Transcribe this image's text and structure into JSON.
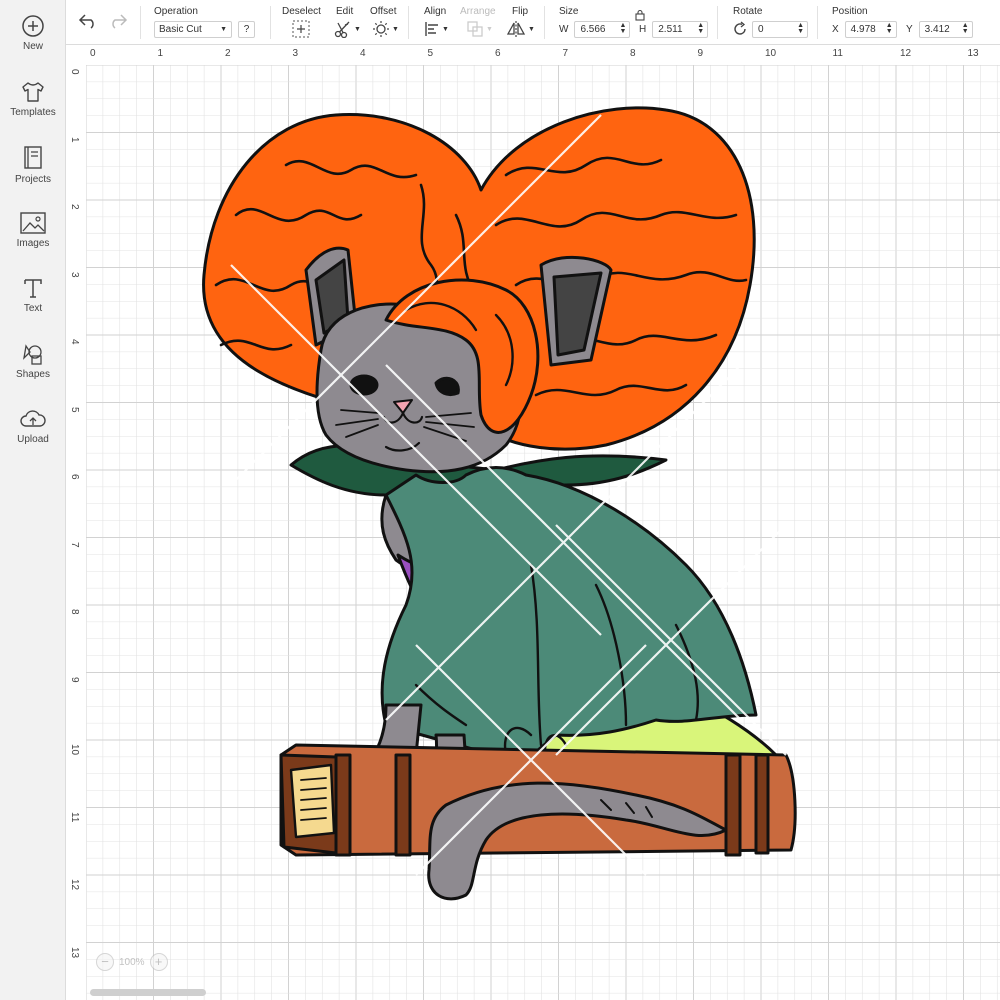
{
  "sidebar": {
    "items": [
      {
        "label": "New",
        "icon": "plus-circle-icon"
      },
      {
        "label": "Templates",
        "icon": "shirt-icon"
      },
      {
        "label": "Projects",
        "icon": "book-icon"
      },
      {
        "label": "Images",
        "icon": "image-icon"
      },
      {
        "label": "Text",
        "icon": "text-icon"
      },
      {
        "label": "Shapes",
        "icon": "shapes-icon"
      },
      {
        "label": "Upload",
        "icon": "cloud-upload-icon"
      }
    ]
  },
  "toolbar": {
    "operation_label": "Operation",
    "operation_value": "Basic Cut",
    "help_label": "?",
    "deselect_label": "Deselect",
    "edit_label": "Edit",
    "offset_label": "Offset",
    "align_label": "Align",
    "arrange_label": "Arrange",
    "flip_label": "Flip",
    "size_label": "Size",
    "w_label": "W",
    "w_value": "6.566",
    "h_label": "H",
    "h_value": "2.511",
    "rotate_label": "Rotate",
    "rotate_value": "0",
    "position_label": "Position",
    "x_label": "X",
    "x_value": "4.978",
    "y_label": "Y",
    "y_value": "3.412"
  },
  "rulers": {
    "top": [
      "0",
      "1",
      "2",
      "3",
      "4",
      "5",
      "6",
      "7",
      "8",
      "9",
      "10",
      "11",
      "12",
      "13"
    ],
    "left": [
      "0",
      "1",
      "2",
      "3",
      "4",
      "5",
      "6",
      "7",
      "8",
      "9",
      "10",
      "11",
      "12",
      "13"
    ]
  },
  "zoom": {
    "minus": "−",
    "value": "100%",
    "plus": "+"
  },
  "colors": {
    "hair": "#ff6410",
    "cat_fur": "#8e8a90",
    "cape": "#4c8a78",
    "collar": "#1f5a3f",
    "dress": "#d9f57a",
    "book": "#c96a3e",
    "book_dark": "#7b3a1a",
    "page": "#f5d98f",
    "scarf": "#9a4fc0",
    "grid": "#e3e3e3"
  }
}
